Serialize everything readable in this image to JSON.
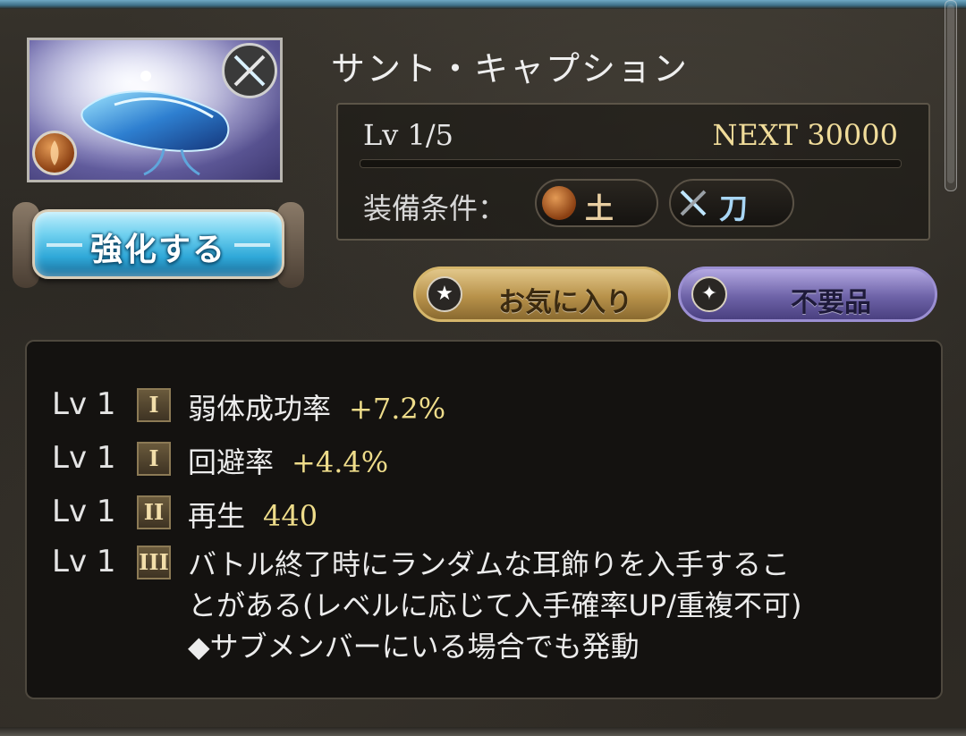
{
  "item": {
    "name": "サント・キャプション",
    "level": "Lv 1/5",
    "next": "NEXT 30000",
    "exp_progress": 0,
    "equip_label": "装備条件：",
    "requirements": [
      {
        "icon": "earth-element-icon",
        "label": "土",
        "color": "#e9cfa2"
      },
      {
        "icon": "sword-crossed-icon",
        "label": "刀",
        "color": "#a8d6f5"
      }
    ]
  },
  "buttons": {
    "enhance": "強化する",
    "favorite": "お気に入り",
    "unneeded": "不要品"
  },
  "skills": [
    {
      "lv": "Lv 1",
      "rank": "I",
      "name": "弱体成功率",
      "value": "+7.2%"
    },
    {
      "lv": "Lv 1",
      "rank": "I",
      "name": "回避率",
      "value": "+4.4%"
    },
    {
      "lv": "Lv 1",
      "rank": "II",
      "name": "再生",
      "value": "440"
    },
    {
      "lv": "Lv 1",
      "rank": "III",
      "lines": [
        "バトル終了時にランダムな耳飾りを入手するこ",
        "とがある(レベルに応じて入手確率UP/重複不可)",
        "◆サブメンバーにいる場合でも発動"
      ]
    }
  ],
  "colors": {
    "accent_gold": "#eedc8a",
    "enhance_blue": "#2fa8d8",
    "favorite_gold": "#b8924a",
    "unneeded_purple": "#6e63a8"
  }
}
